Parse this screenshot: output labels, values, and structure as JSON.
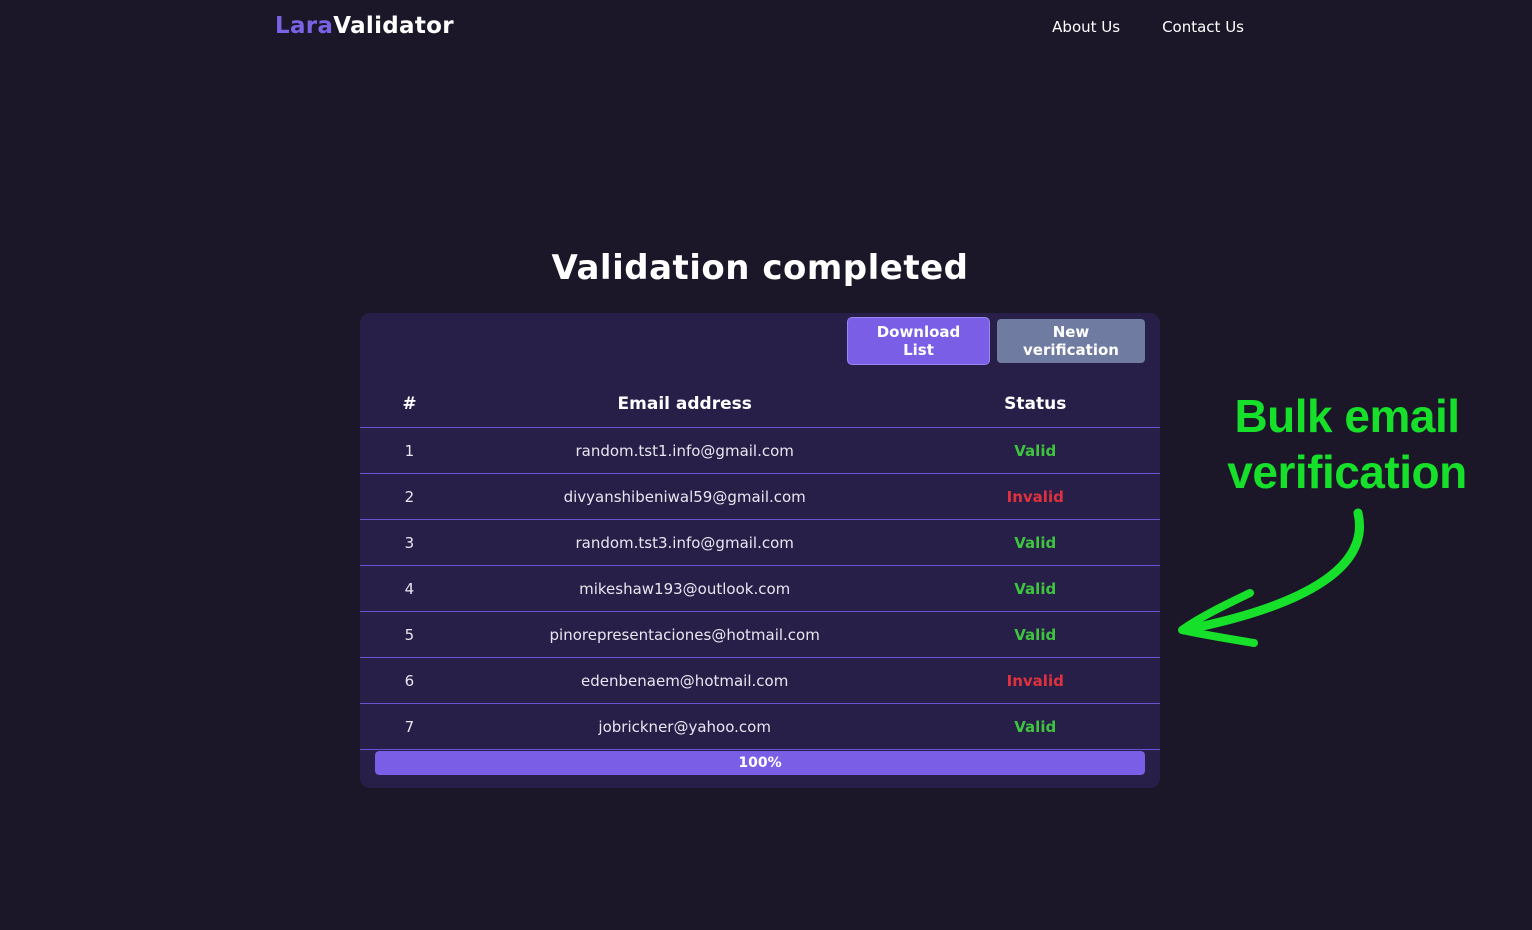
{
  "header": {
    "logo_part1": "Lara",
    "logo_part2": "Validator",
    "nav": [
      "About Us",
      "Contact Us"
    ]
  },
  "title": "Validation completed",
  "buttons": {
    "download": "Download List",
    "new_verification": "New verification"
  },
  "table": {
    "headers": [
      "#",
      "Email address",
      "Status"
    ],
    "rows": [
      {
        "num": "1",
        "email": "random.tst1.info@gmail.com",
        "status": "Valid"
      },
      {
        "num": "2",
        "email": "divyanshibeniwal59@gmail.com",
        "status": "Invalid"
      },
      {
        "num": "3",
        "email": "random.tst3.info@gmail.com",
        "status": "Valid"
      },
      {
        "num": "4",
        "email": "mikeshaw193@outlook.com",
        "status": "Valid"
      },
      {
        "num": "5",
        "email": "pinorepresentaciones@hotmail.com",
        "status": "Valid"
      },
      {
        "num": "6",
        "email": "edenbenaem@hotmail.com",
        "status": "Invalid"
      },
      {
        "num": "7",
        "email": "jobrickner@yahoo.com",
        "status": "Valid"
      }
    ]
  },
  "progress": {
    "value": 100,
    "label": "100%"
  },
  "annotation": {
    "line1": "Bulk email",
    "line2": "verification",
    "icon": "curved-arrow-icon"
  },
  "colors": {
    "accent": "#7a5fe6",
    "valid": "#3ec43e",
    "invalid": "#e0323e",
    "annotation": "#17e02a",
    "background": "#1b1729",
    "card": "#271f48"
  }
}
